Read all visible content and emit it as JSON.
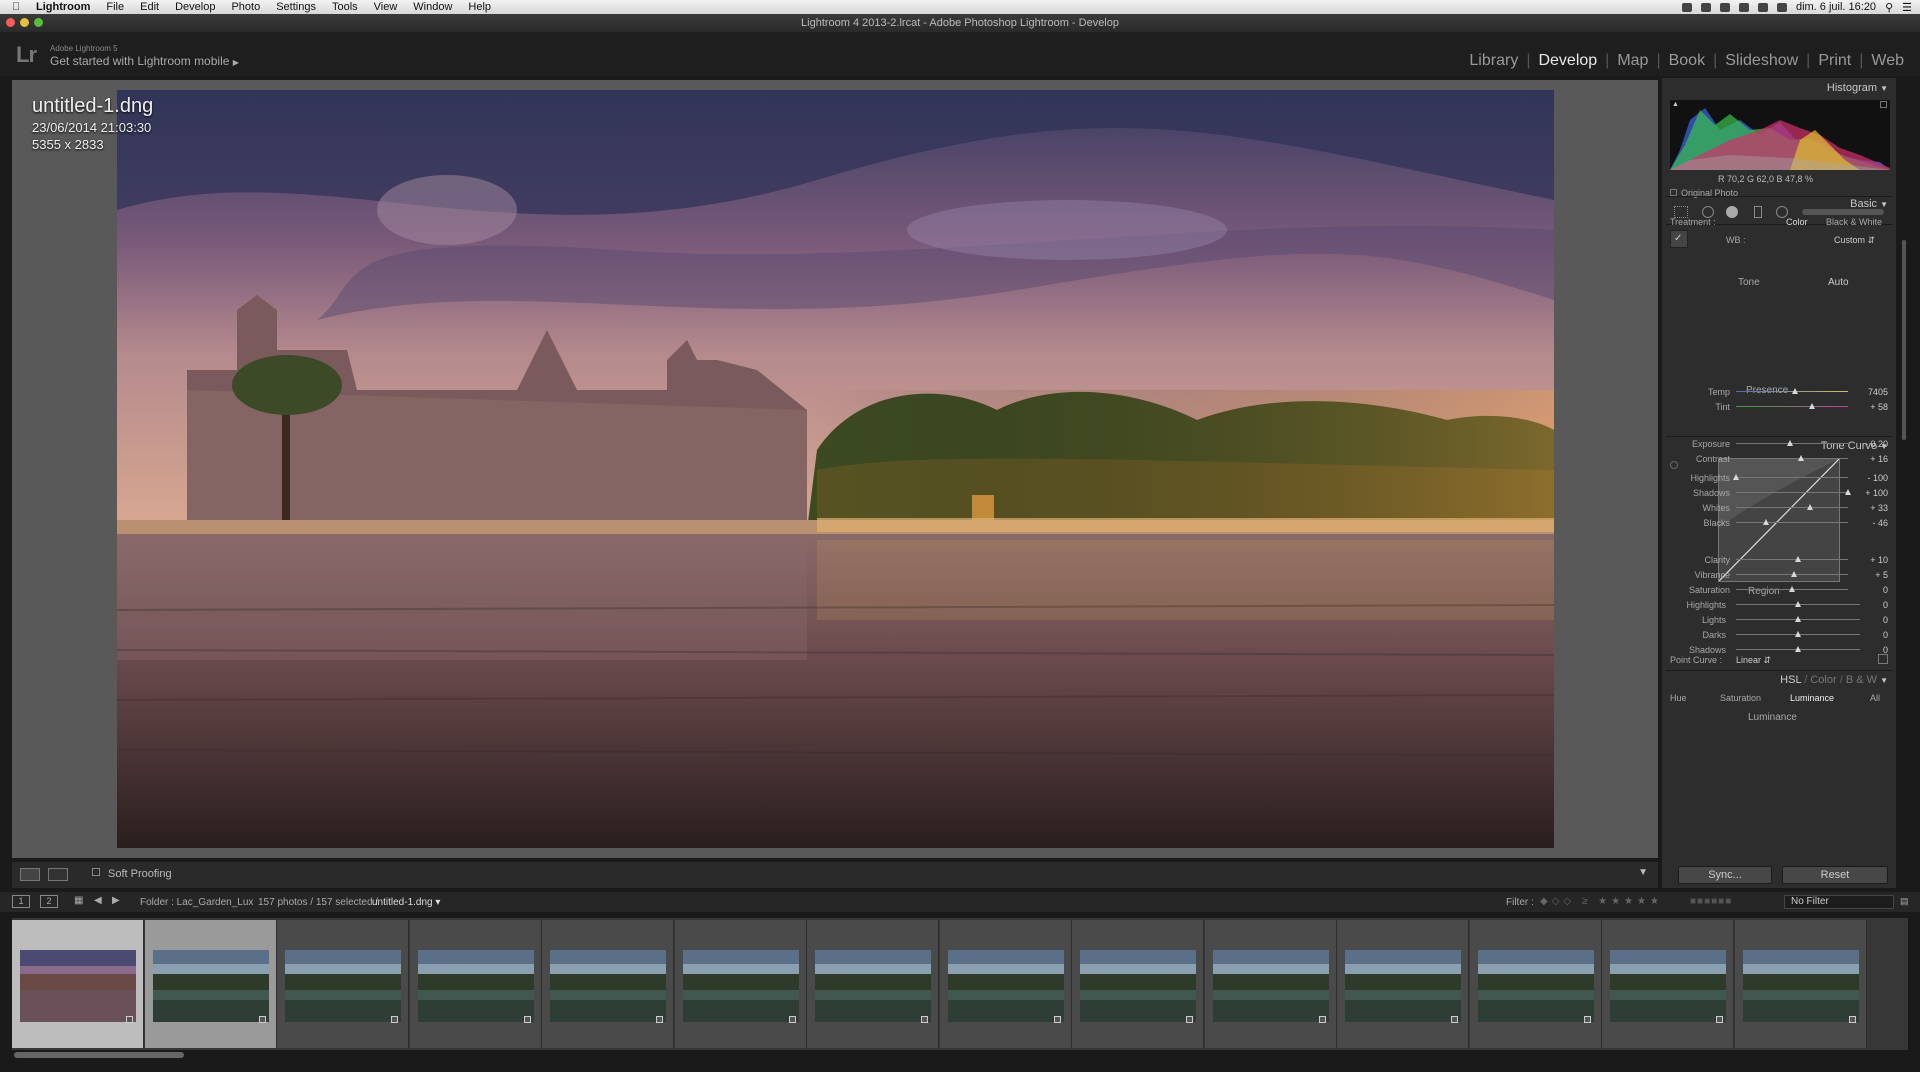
{
  "menubar": {
    "items": [
      "Lightroom",
      "File",
      "Edit",
      "Develop",
      "Photo",
      "Settings",
      "Tools",
      "View",
      "Window",
      "Help"
    ],
    "clock": "dim. 6 juil.  16:20"
  },
  "window": {
    "title": "Lightroom 4 2013-2.lrcat - Adobe Photoshop Lightroom - Develop"
  },
  "topbar": {
    "logo": "Lr",
    "product": "Adobe Lightroom 5",
    "mobile_prompt": "Get started with Lightroom mobile",
    "modules": [
      "Library",
      "Develop",
      "Map",
      "Book",
      "Slideshow",
      "Print",
      "Web"
    ],
    "active_module": "Develop"
  },
  "photo_info": {
    "filename": "untitled-1.dng",
    "datetime": "23/06/2014 21:03:30",
    "dimensions": "5355 x 2833"
  },
  "toolbar": {
    "soft_proofing": "Soft Proofing"
  },
  "histogram": {
    "title": "Histogram",
    "rgb": "R  70,2  G  62,0  B  47,8 %",
    "original_photo": "Original Photo"
  },
  "basic": {
    "title": "Basic",
    "treatment_label": "Treatment :",
    "treatment_color": "Color",
    "treatment_bw": "Black & White",
    "wb_label": "WB :",
    "wb_value": "Custom",
    "tone_label": "Tone",
    "auto": "Auto",
    "presence_label": "Presence",
    "sliders": [
      {
        "name": "Temp",
        "value": "7405",
        "pos": 0.53
      },
      {
        "name": "Tint",
        "value": "+ 58",
        "pos": 0.68
      },
      {
        "name": "Exposure",
        "value": "- 0,20",
        "pos": 0.48
      },
      {
        "name": "Contrast",
        "value": "+ 16",
        "pos": 0.58
      },
      {
        "name": "Highlights",
        "value": "- 100",
        "pos": 0.0
      },
      {
        "name": "Shadows",
        "value": "+ 100",
        "pos": 1.0
      },
      {
        "name": "Whites",
        "value": "+ 33",
        "pos": 0.66
      },
      {
        "name": "Blacks",
        "value": "- 46",
        "pos": 0.27
      },
      {
        "name": "Clarity",
        "value": "+ 10",
        "pos": 0.55
      },
      {
        "name": "Vibrance",
        "value": "+ 5",
        "pos": 0.52
      },
      {
        "name": "Saturation",
        "value": "0",
        "pos": 0.5
      }
    ]
  },
  "tone_curve": {
    "title": "Tone Curve",
    "region_label": "Region",
    "regions": [
      {
        "name": "Highlights",
        "value": "0",
        "pos": 0.5
      },
      {
        "name": "Lights",
        "value": "0",
        "pos": 0.5
      },
      {
        "name": "Darks",
        "value": "0",
        "pos": 0.5
      },
      {
        "name": "Shadows",
        "value": "0",
        "pos": 0.5
      }
    ],
    "point_curve_label": "Point Curve :",
    "point_curve_value": "Linear"
  },
  "hsl": {
    "title_hsl": "HSL",
    "title_color": "Color",
    "title_bw": "B & W",
    "tabs": [
      "Hue",
      "Saturation",
      "Luminance",
      "All"
    ],
    "active_tab": "Luminance",
    "section": "Luminance"
  },
  "buttons": {
    "sync": "Sync...",
    "reset": "Reset"
  },
  "filmstrip_header": {
    "page1": "1",
    "page2": "2",
    "folder": "Folder : Lac_Garden_Lux",
    "count": "157 photos / 157 selected /",
    "current": "untitled-1.dng",
    "filter_label": "Filter :",
    "filter_value": "No Filter"
  },
  "filmstrip": {
    "thumb_count": 14,
    "current_index": 0
  }
}
